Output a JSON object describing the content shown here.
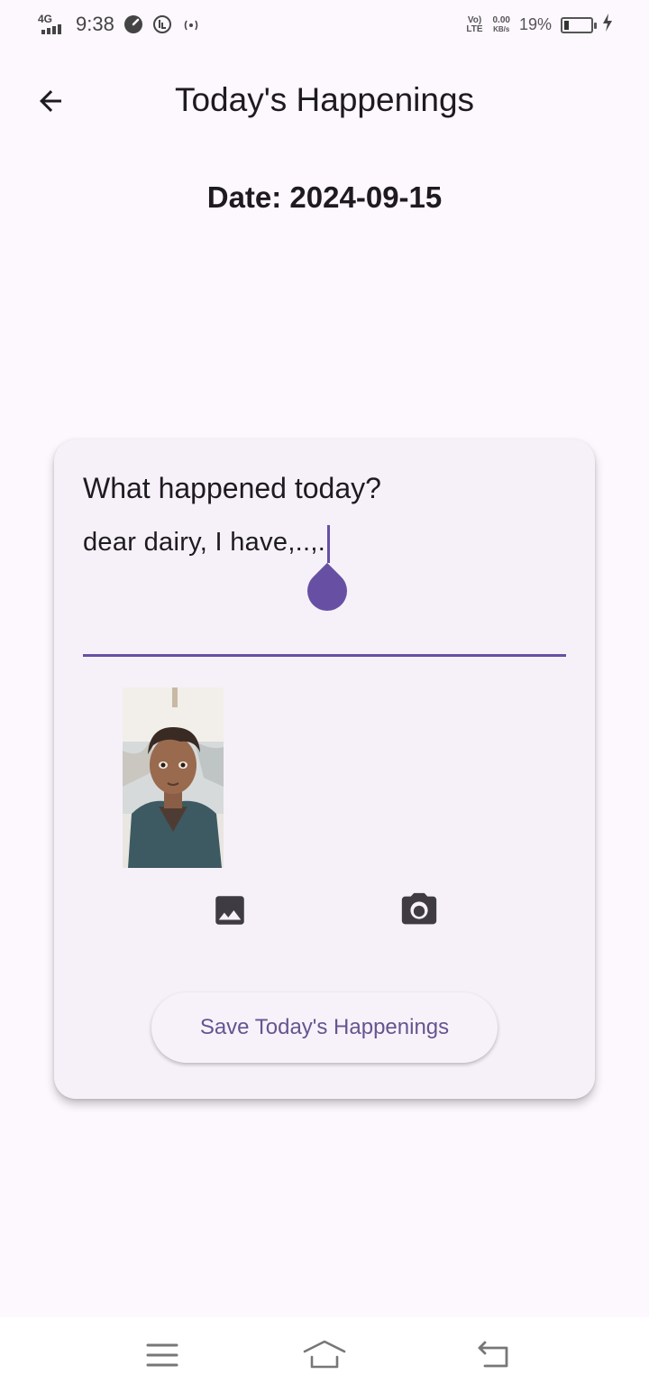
{
  "status_bar": {
    "network": "4G",
    "time": "9:38",
    "volte": "Vo) LTE",
    "speed_value": "0.00",
    "speed_unit": "KB/s",
    "battery_percent": "19%",
    "battery_level": 0.19,
    "icons": [
      "signal-icon",
      "speedometer-icon",
      "vpn-icon",
      "hotspot-icon",
      "battery-icon",
      "charging-icon"
    ]
  },
  "app_bar": {
    "title": "Today's Happenings",
    "back_icon": "arrow-back-icon"
  },
  "date_line": "Date: 2024-09-15",
  "card": {
    "field_label": "What happened today?",
    "field_value": "dear dairy, I have,..,.",
    "accent_color": "#6750a4",
    "gallery_icon": "image-icon",
    "camera_icon": "camera-icon",
    "save_label": "Save Today's Happenings"
  },
  "nav_bar": {
    "icons": [
      "menu-icon",
      "home-icon",
      "back-icon"
    ]
  }
}
